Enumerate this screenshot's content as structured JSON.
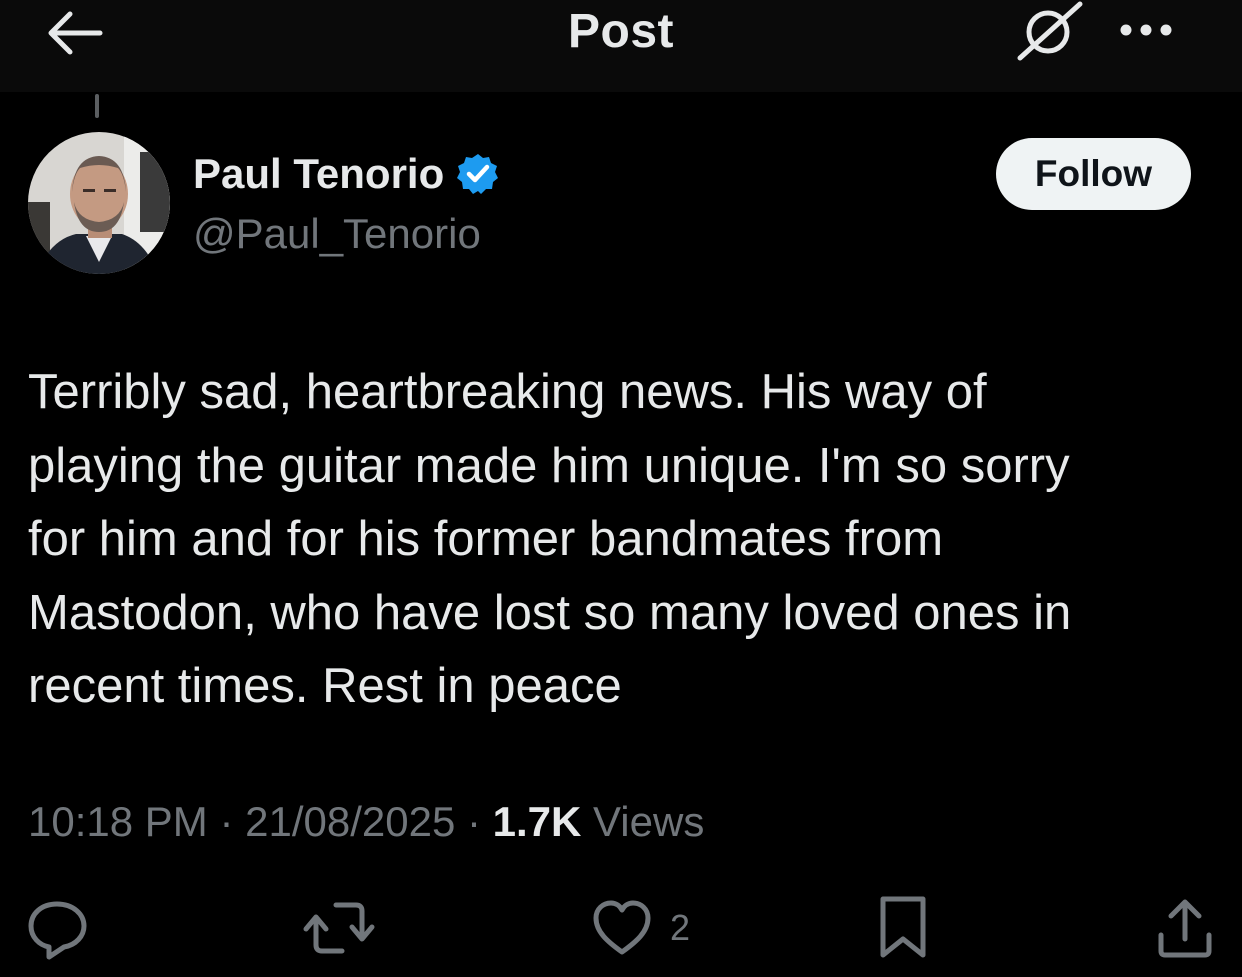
{
  "header": {
    "title": "Post",
    "back_icon": "arrow-left-icon",
    "grok_icon": "grok-icon",
    "more_icon": "more-horizontal-icon"
  },
  "author": {
    "display_name": "Paul Tenorio",
    "handle": "@Paul_Tenorio",
    "verified": true,
    "verified_color": "#1d9bf0"
  },
  "follow_button": {
    "label": "Follow"
  },
  "post": {
    "text": "Terribly sad, heartbreaking news. His way of\nplaying the guitar made him unique. I'm so sorry\nfor him and for his former bandmates from\nMastodon, who have lost so many loved ones in\nrecent times. Rest in peace",
    "time": "10:18 PM",
    "separator": " · ",
    "date": "21/08/2025",
    "views_count": "1.7K",
    "views_label": " Views"
  },
  "actions": {
    "reply_icon": "reply-icon",
    "repost_icon": "repost-icon",
    "like_icon": "heart-icon",
    "like_count": "2",
    "bookmark_icon": "bookmark-icon",
    "share_icon": "share-icon"
  },
  "colors": {
    "background": "#000000",
    "text_primary": "#e7e9ea",
    "text_secondary": "#71767b",
    "follow_bg": "#eff3f4"
  }
}
